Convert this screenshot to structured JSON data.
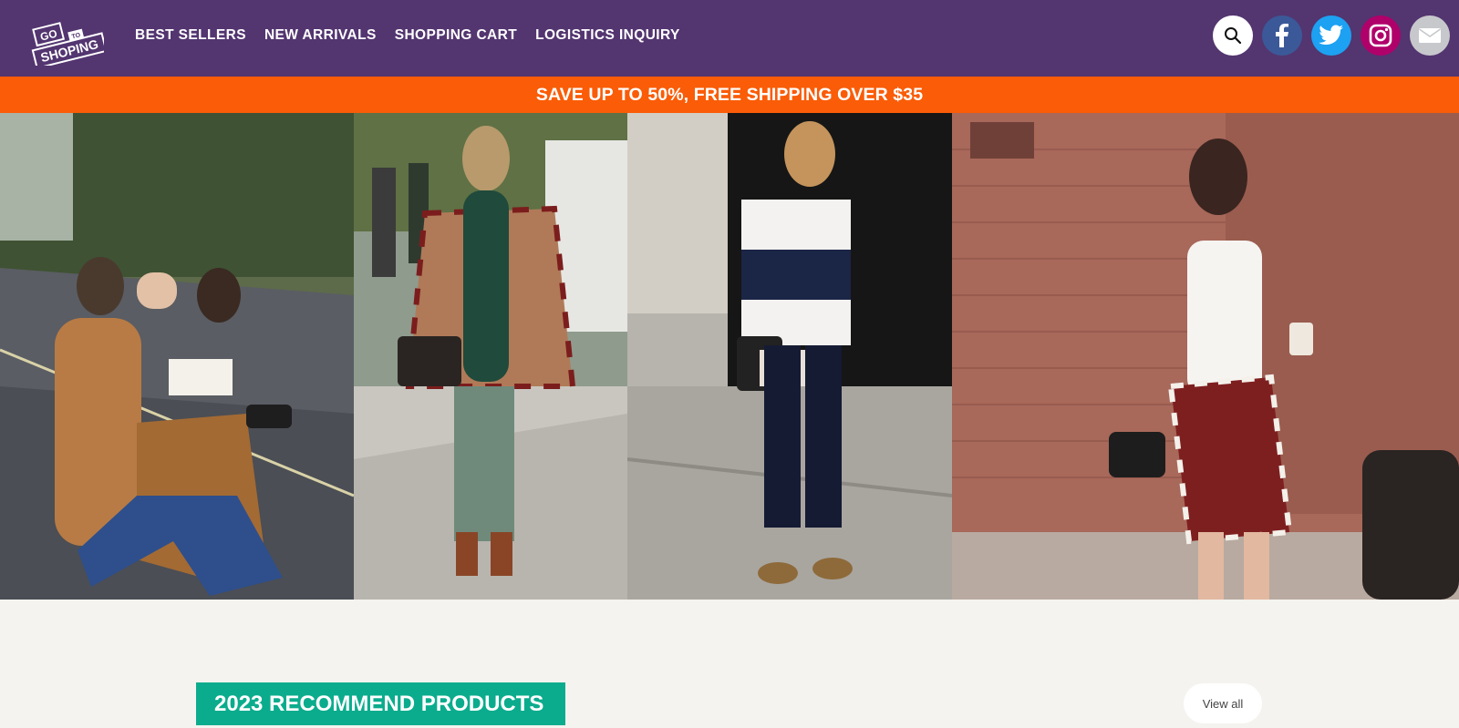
{
  "header": {
    "logo": {
      "icon": "go-to-shoping-logo",
      "line1": "GO",
      "line2": "TO",
      "line3": "SHOPING"
    },
    "nav": [
      {
        "label": "BEST SELLERS"
      },
      {
        "label": "NEW ARRIVALS"
      },
      {
        "label": "SHOPPING CART"
      },
      {
        "label": "LOGISTICS INQUIRY"
      }
    ],
    "social": [
      {
        "icon": "search-icon",
        "color": "#ffffff"
      },
      {
        "icon": "facebook-icon",
        "color": "#3b5998"
      },
      {
        "icon": "twitter-icon",
        "color": "#1da1f2"
      },
      {
        "icon": "instagram-icon",
        "color": "#b0006a"
      },
      {
        "icon": "mail-icon",
        "color": "#c7c8cc"
      }
    ],
    "background": "#533570"
  },
  "promo": {
    "text": "SAVE UP TO 50%, FREE SHIPPING OVER $35",
    "color": "#fa5c07"
  },
  "hero": {
    "panels": [
      {
        "alt": "two women crossing street in tan outfits"
      },
      {
        "alt": "woman in plaid poncho and green scarf"
      },
      {
        "alt": "woman in navy and white striped top"
      },
      {
        "alt": "woman in white tee with plaid skirt and black bag"
      }
    ]
  },
  "recommend": {
    "title": "2023 RECOMMEND PRODUCTS",
    "view_all": "View all",
    "accent": "#0bac8d"
  }
}
